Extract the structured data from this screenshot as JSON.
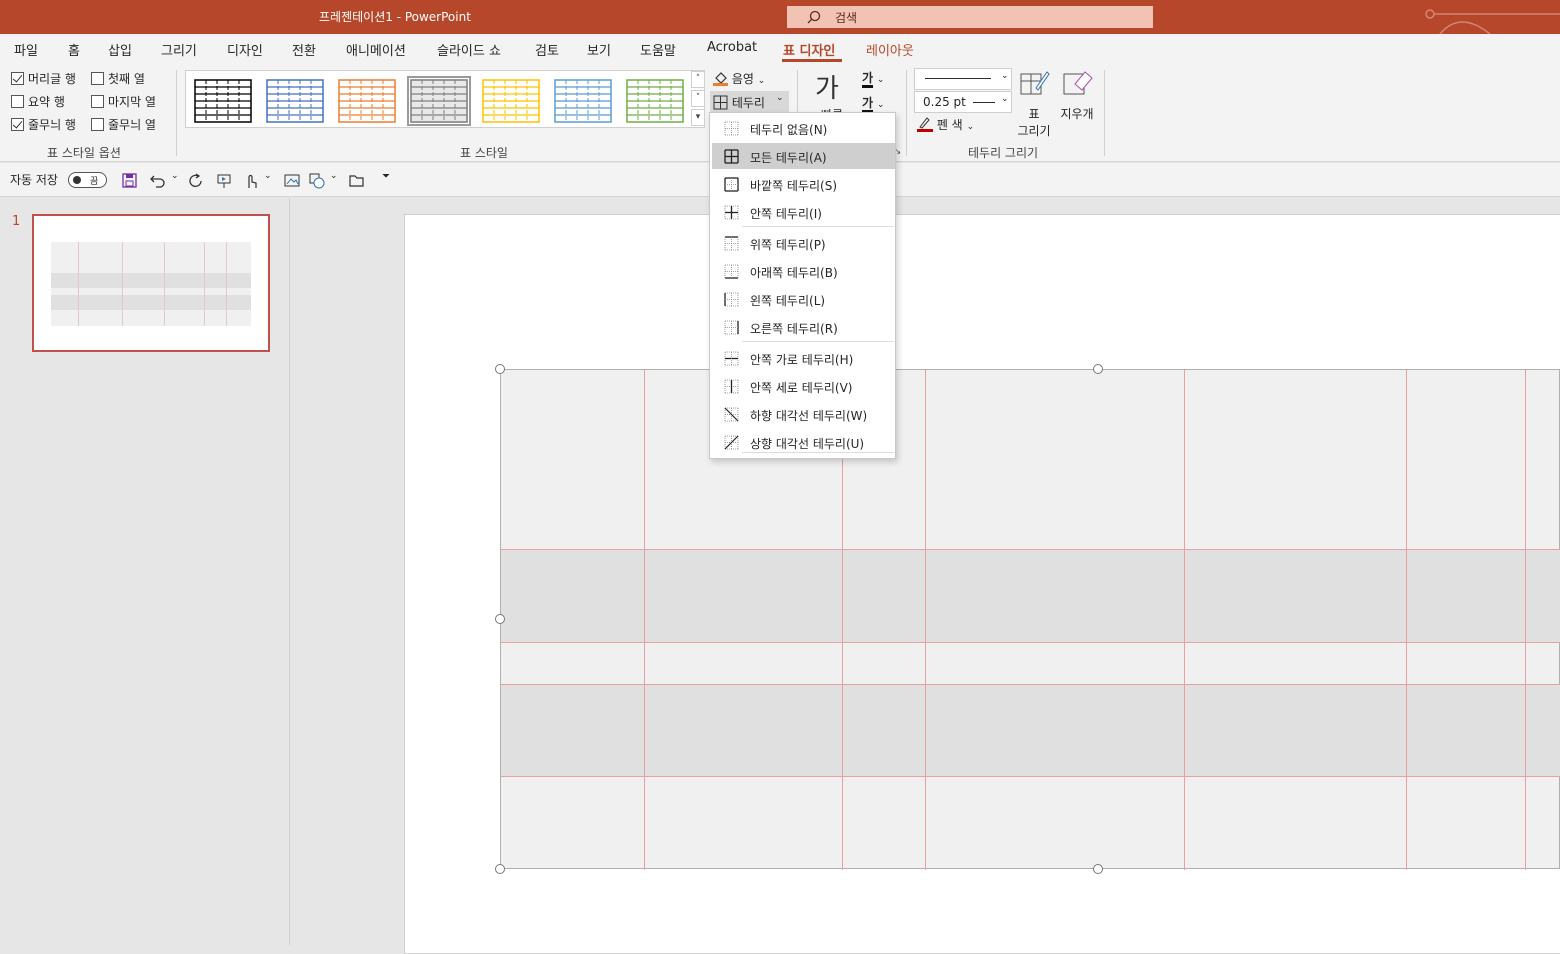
{
  "titlebar": {
    "title": "프레젠테이션1  -  PowerPoint",
    "search_placeholder": "검색"
  },
  "menu": {
    "tabs": [
      "파일",
      "홈",
      "삽입",
      "그리기",
      "디자인",
      "전환",
      "애니메이션",
      "슬라이드 쇼",
      "검토",
      "보기",
      "도움말",
      "Acrobat",
      "표 디자인",
      "레이아웃"
    ],
    "active": "표 디자인"
  },
  "style_options": {
    "items": [
      {
        "label": "머리글 행",
        "checked": true
      },
      {
        "label": "첫째 열",
        "checked": false
      },
      {
        "label": "요약 행",
        "checked": false
      },
      {
        "label": "마지막 열",
        "checked": false
      },
      {
        "label": "줄무늬 행",
        "checked": true
      },
      {
        "label": "줄무늬 열",
        "checked": false
      }
    ],
    "group_label": "표 스타일 옵션"
  },
  "table_styles": {
    "group_label": "표 스타일",
    "swatch_colors": [
      "#000000",
      "#4472c4",
      "#ed7d31",
      "#7f7f7f",
      "#ffc000",
      "#5b9bd5",
      "#70ad47"
    ],
    "selected_index": 3
  },
  "ribbon": {
    "shading": "음영",
    "borders": "테두리",
    "quick_styles": "빠른",
    "ga1": "가",
    "ga2": "가",
    "pen_weight": "0.25 pt",
    "pen_color": "펜 색",
    "draw_table_line1": "표",
    "draw_table_line2": "그리기",
    "eraser": "지우개",
    "draw_borders_group": "테두리 그리기"
  },
  "qat": {
    "autosave": "자동 저장",
    "toggle_state": "끔"
  },
  "slides": {
    "number": "1"
  },
  "border_menu": [
    {
      "label": "테두리 없음(N)",
      "icon": "no-border-icon"
    },
    {
      "label": "모든 테두리(A)",
      "icon": "all-borders-icon",
      "highlighted": true
    },
    {
      "label": "바깥쪽 테두리(S)",
      "icon": "outside-borders-icon"
    },
    {
      "label": "안쪽 테두리(I)",
      "icon": "inside-borders-icon"
    },
    {
      "label": "위쪽 테두리(P)",
      "icon": "top-border-icon"
    },
    {
      "label": "아래쪽 테두리(B)",
      "icon": "bottom-border-icon"
    },
    {
      "label": "왼쪽 테두리(L)",
      "icon": "left-border-icon"
    },
    {
      "label": "오른쪽 테두리(R)",
      "icon": "right-border-icon"
    },
    {
      "label": "안쪽 가로 테두리(H)",
      "icon": "inside-horizontal-border-icon"
    },
    {
      "label": "안쪽 세로 테두리(V)",
      "icon": "inside-vertical-border-icon"
    },
    {
      "label": "하향 대각선 테두리(W)",
      "icon": "diagonal-down-border-icon"
    },
    {
      "label": "상향 대각선 테두리(U)",
      "icon": "diagonal-up-border-icon"
    }
  ],
  "colors": {
    "accent": "#b7472a",
    "gridline": "#e8a0a0",
    "band": "#e0e0e0",
    "row": "#f0f0f0"
  }
}
